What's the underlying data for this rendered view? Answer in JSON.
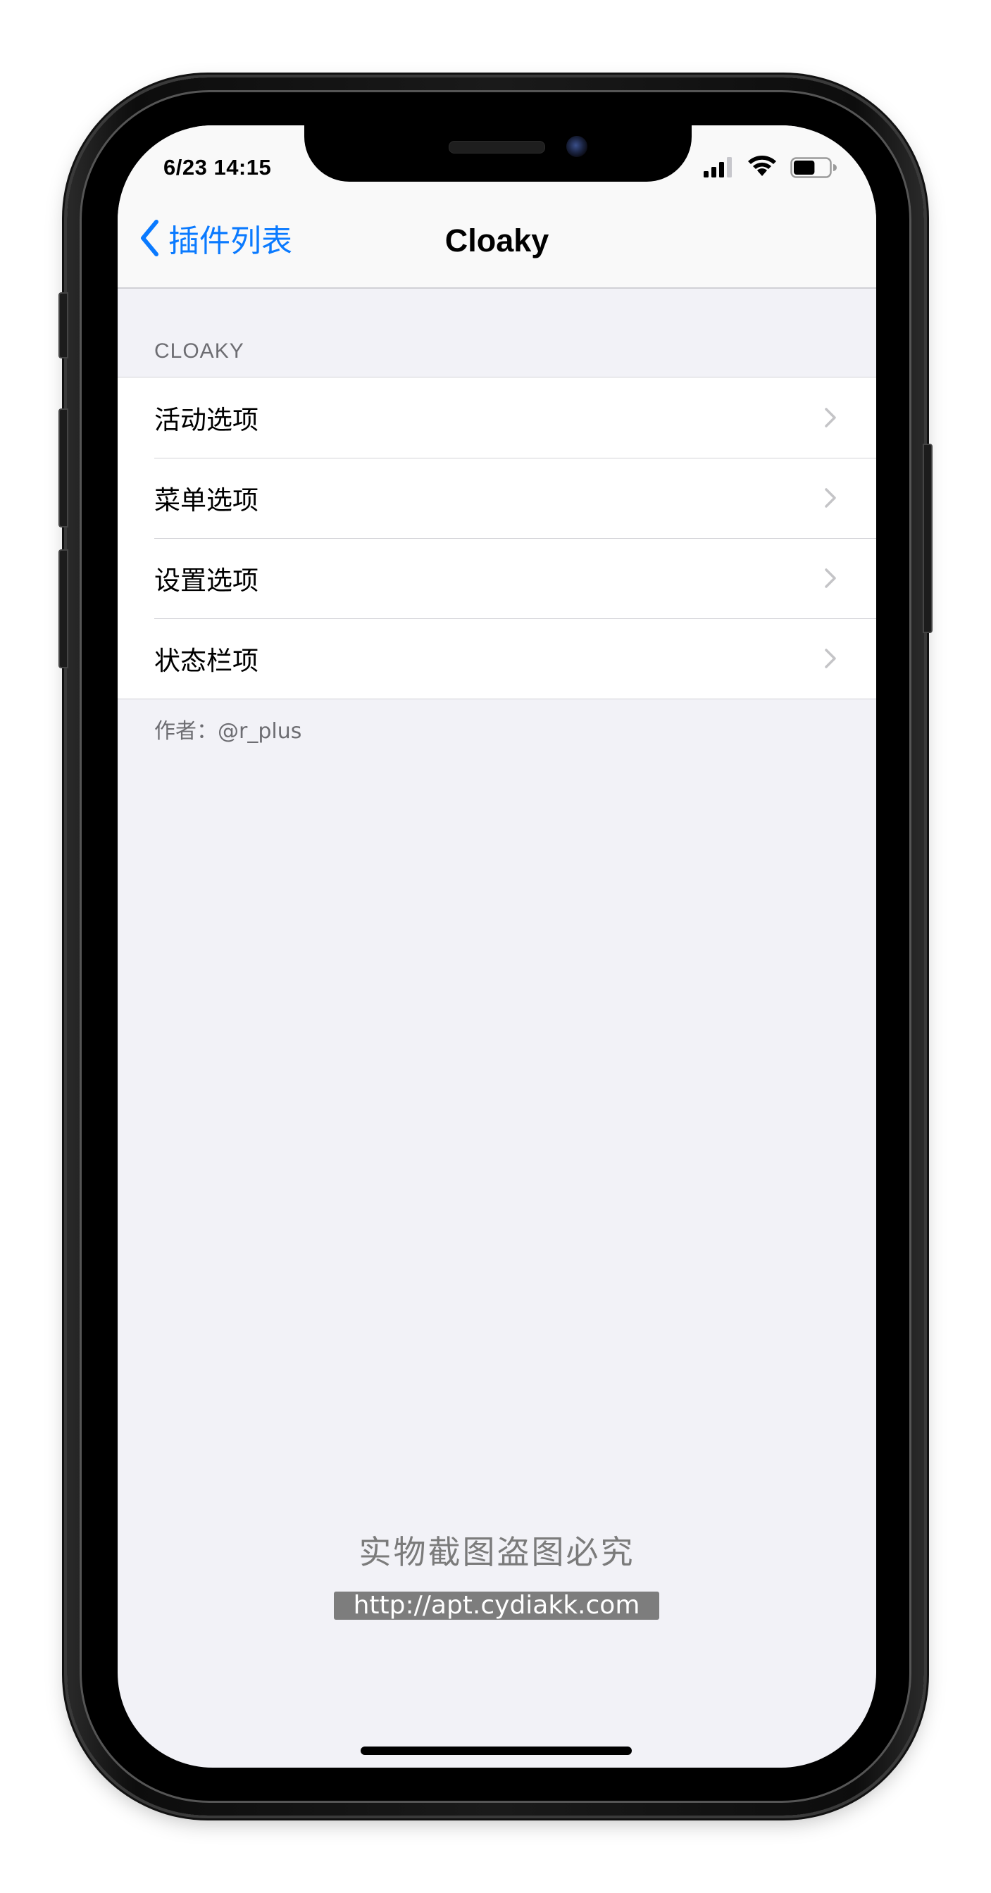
{
  "status_bar": {
    "time": "6/23 14:15",
    "icons": [
      "signal-icon",
      "wifi-icon",
      "battery-icon"
    ],
    "battery_level": 0.6
  },
  "nav": {
    "back_label": "插件列表",
    "title": "Cloaky"
  },
  "section": {
    "header": "CLOAKY",
    "rows": [
      {
        "label": "活动选项"
      },
      {
        "label": "菜单选项"
      },
      {
        "label": "设置选项"
      },
      {
        "label": "状态栏项"
      }
    ],
    "footer": "作者：@r_plus"
  },
  "watermark": {
    "text": "实物截图盗图必究",
    "url": "http://apt.cydiakk.com"
  },
  "colors": {
    "accent": "#0a7aff",
    "background": "#f2f2f7",
    "secondary_text": "#6d6d72"
  }
}
